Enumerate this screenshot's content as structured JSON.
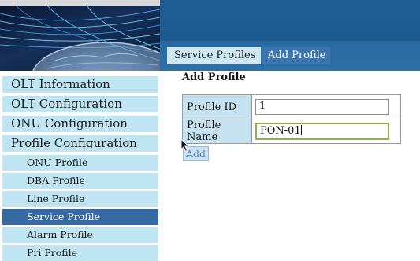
{
  "sidebar": {
    "main_items": [
      {
        "label": "OLT Information"
      },
      {
        "label": "OLT Configuration"
      },
      {
        "label": "ONU Configuration"
      },
      {
        "label": "Profile Configuration"
      }
    ],
    "sub_items": [
      {
        "label": "ONU Profile",
        "active": false
      },
      {
        "label": "DBA Profile",
        "active": false
      },
      {
        "label": "Line Profile",
        "active": false
      },
      {
        "label": "Service Profile",
        "active": true
      },
      {
        "label": "Alarm Profile",
        "active": false
      },
      {
        "label": "Pri Profile",
        "active": false
      }
    ]
  },
  "tabs": [
    {
      "label": "Service Profiles",
      "active": false
    },
    {
      "label": "Add Profile",
      "active": true
    }
  ],
  "form": {
    "heading": "Add Profile",
    "profile_id_label": "Profile ID",
    "profile_id_value": "1",
    "profile_name_label": "Profile Name",
    "profile_name_value": "PON-01",
    "add_button_label": "Add"
  },
  "colors": {
    "banner_blue": "#1e5d93",
    "menu_bg": "#bfe4f2",
    "menu_active": "#3569a4",
    "tab_active": "#3c76b0",
    "focus_border": "#8ab04f"
  }
}
